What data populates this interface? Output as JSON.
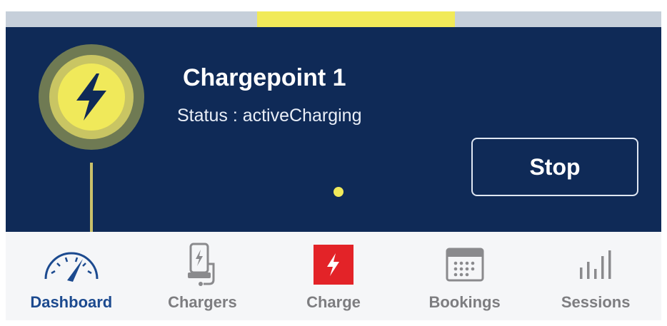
{
  "chargepoint": {
    "title": "Chargepoint 1",
    "status": "Status : activeCharging",
    "stop_label": "Stop"
  },
  "colors": {
    "panel_bg": "#0f2a57",
    "accent_yellow": "#f0e95a",
    "active_tab": "#1c4a8f",
    "inactive_tab": "#7d7d80",
    "charge_red": "#e32328"
  },
  "tabs": [
    {
      "label": "Dashboard",
      "icon": "speedometer-icon",
      "active": true
    },
    {
      "label": "Chargers",
      "icon": "charger-icon",
      "active": false
    },
    {
      "label": "Charge",
      "icon": "lightning-icon",
      "active": false
    },
    {
      "label": "Bookings",
      "icon": "calendar-icon",
      "active": false
    },
    {
      "label": "Sessions",
      "icon": "bar-chart-icon",
      "active": false
    }
  ]
}
